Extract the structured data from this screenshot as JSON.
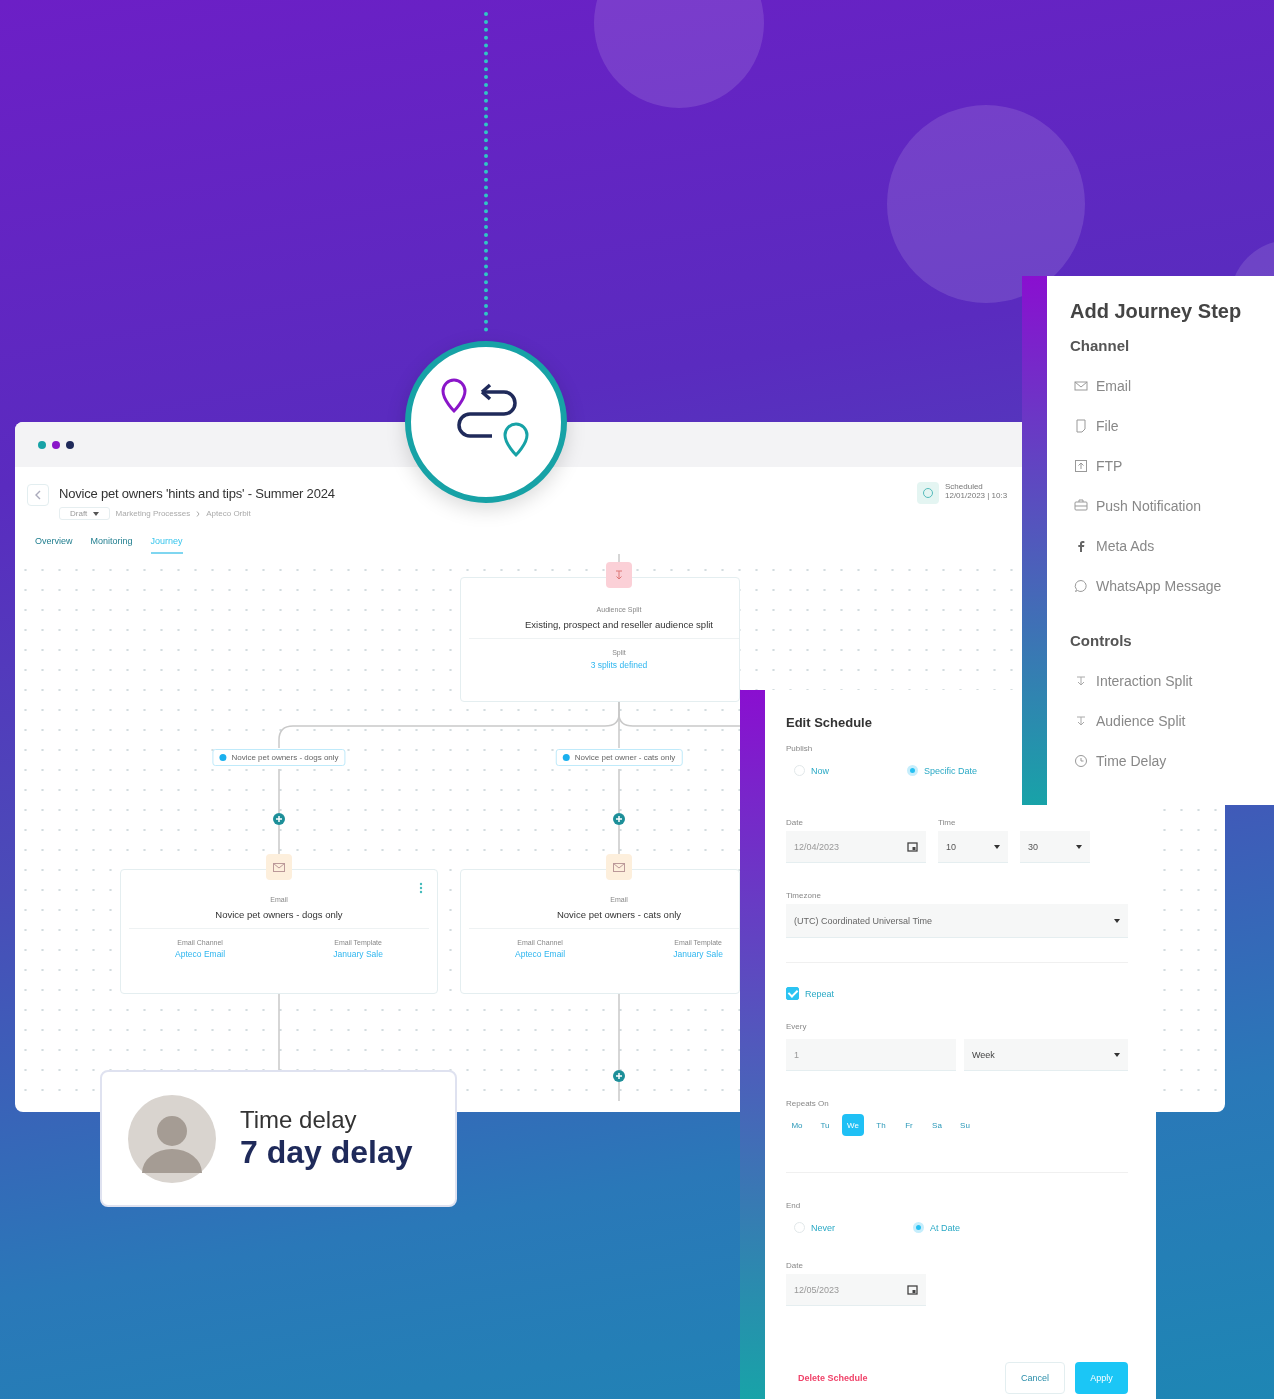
{
  "main_window": {
    "title": "Novice pet owners 'hints and tips' - Summer 2024",
    "status": "Draft",
    "breadcrumb": [
      "Marketing Processes",
      "Apteco Orbit"
    ],
    "schedule": {
      "label": "Scheduled",
      "date": "12/01/2023 | 10:3"
    },
    "tabs": [
      {
        "label": "Overview",
        "selected": false
      },
      {
        "label": "Monitoring",
        "selected": false
      },
      {
        "label": "Journey",
        "selected": true
      }
    ],
    "split_node": {
      "type": "Audience Split",
      "title": "Existing, prospect and reseller audience split",
      "field_label": "Split",
      "field_value": "3 splits defined"
    },
    "branches": [
      {
        "label": "Novice pet owners - dogs only",
        "node": {
          "type": "Email",
          "title": "Novice pet owners - dogs only",
          "fields": [
            {
              "label": "Email Channel",
              "value": "Apteco Email"
            },
            {
              "label": "Email Template",
              "value": "January Sale"
            }
          ]
        }
      },
      {
        "label": "Novice pet owner - cats only",
        "node": {
          "type": "Email",
          "title": "Novice pet owners - cats only",
          "fields": [
            {
              "label": "Email Channel",
              "value": "Apteco Email"
            },
            {
              "label": "Email Template",
              "value": "January Sale"
            }
          ]
        }
      }
    ]
  },
  "delay_card": {
    "label": "Time delay",
    "value": "7 day delay"
  },
  "add_step": {
    "title": "Add Journey Step",
    "sections": [
      {
        "heading": "Channel",
        "items": [
          {
            "label": "Email",
            "kind": "email"
          },
          {
            "label": "File",
            "kind": "file"
          },
          {
            "label": "FTP",
            "kind": "ftp"
          },
          {
            "label": "Push Notification",
            "kind": "push"
          },
          {
            "label": "Meta Ads",
            "kind": "meta"
          },
          {
            "label": "WhatsApp Message",
            "kind": "whatsapp"
          }
        ]
      },
      {
        "heading": "Controls",
        "items": [
          {
            "label": "Interaction Split",
            "kind": "split"
          },
          {
            "label": "Audience Split",
            "kind": "split"
          },
          {
            "label": "Time Delay",
            "kind": "clock"
          }
        ]
      }
    ]
  },
  "schedule_panel": {
    "title": "Edit Schedule",
    "publish_label": "Publish",
    "publish_options": [
      {
        "label": "Now",
        "selected": false
      },
      {
        "label": "Specific Date",
        "selected": true
      }
    ],
    "date_label": "Date",
    "date": "12/04/2023",
    "time_label": "Time",
    "hour": "10",
    "minute": "30",
    "timezone_label": "Timezone",
    "timezone": "(UTC) Coordinated Universal Time",
    "repeat": {
      "label": "Repeat",
      "checked": true
    },
    "every_label": "Every",
    "every_count": "1",
    "every_unit": "Week",
    "repeats_on_label": "Repeats On",
    "days": [
      {
        "label": "Mo",
        "selected": false
      },
      {
        "label": "Tu",
        "selected": false
      },
      {
        "label": "We",
        "selected": true
      },
      {
        "label": "Th",
        "selected": false
      },
      {
        "label": "Fr",
        "selected": false
      },
      {
        "label": "Sa",
        "selected": false
      },
      {
        "label": "Su",
        "selected": false
      }
    ],
    "end_label": "End",
    "end_options": [
      {
        "label": "Never",
        "selected": false
      },
      {
        "label": "At Date",
        "selected": true
      }
    ],
    "end_date_label": "Date",
    "end_date": "12/05/2023",
    "delete_label": "Delete Schedule",
    "cancel_label": "Cancel",
    "apply_label": "Apply"
  }
}
